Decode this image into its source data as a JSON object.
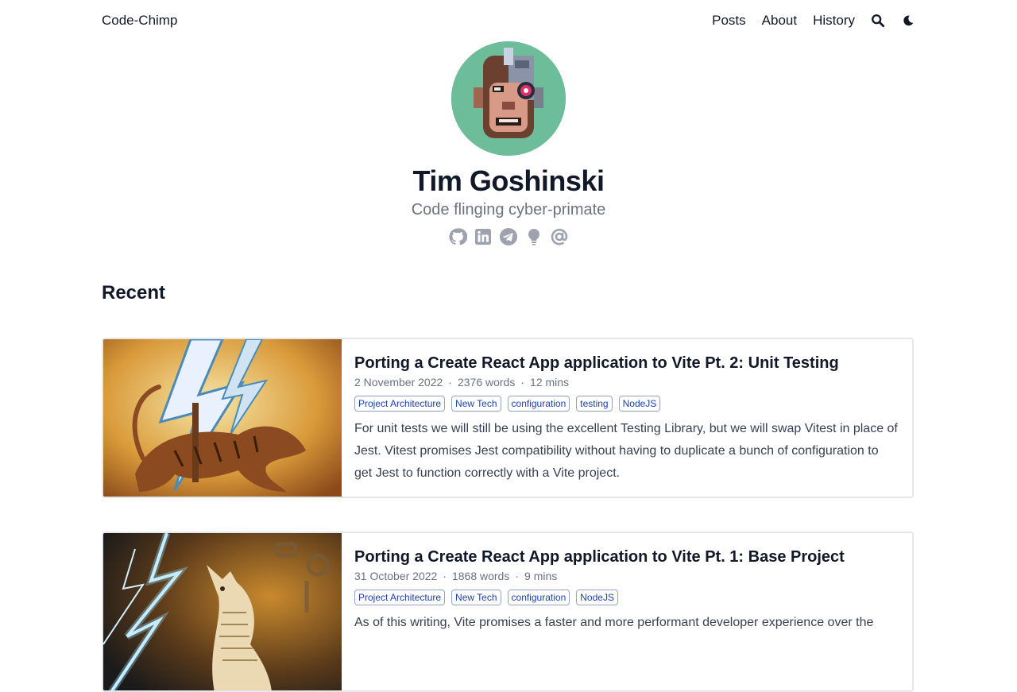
{
  "header": {
    "site_title": "Code-Chimp",
    "nav": [
      {
        "label": "Posts"
      },
      {
        "label": "About"
      },
      {
        "label": "History"
      }
    ],
    "search_icon": "search-icon",
    "theme_icon": "moon-icon"
  },
  "profile": {
    "name": "Tim Goshinski",
    "headline": "Code flinging cyber-primate",
    "social": [
      {
        "icon": "github-icon"
      },
      {
        "icon": "linkedin-icon"
      },
      {
        "icon": "telegram-icon"
      },
      {
        "icon": "lightbulb-icon"
      },
      {
        "icon": "at-icon"
      }
    ]
  },
  "recent": {
    "title": "Recent",
    "posts": [
      {
        "title": "Porting a Create React App application to Vite Pt. 2: Unit Testing",
        "date": "2 November 2022",
        "words": "2376 words",
        "reading_time": "12 mins",
        "tags": [
          "Project Architecture",
          "New Tech",
          "configuration",
          "testing",
          "NodeJS"
        ],
        "summary": "For unit tests we will still be using the excellent Testing Library, but we will swap Vitest in place of Jest. Vitest promises Jest compatibility without having to duplicate a bunch of configuration to get Jest to function correctly with a Vite project."
      },
      {
        "title": "Porting a Create React App application to Vite Pt. 1: Base Project",
        "date": "31 October 2022",
        "words": "1868 words",
        "reading_time": "9 mins",
        "tags": [
          "Project Architecture",
          "New Tech",
          "configuration",
          "NodeJS"
        ],
        "summary": "As of this writing, Vite promises a faster and more performant developer experience over the"
      }
    ]
  },
  "colors": {
    "text": "#111827",
    "muted": "#6b7280",
    "tag_text": "#1e40af",
    "avatar_bg": "#6dbd9a"
  }
}
